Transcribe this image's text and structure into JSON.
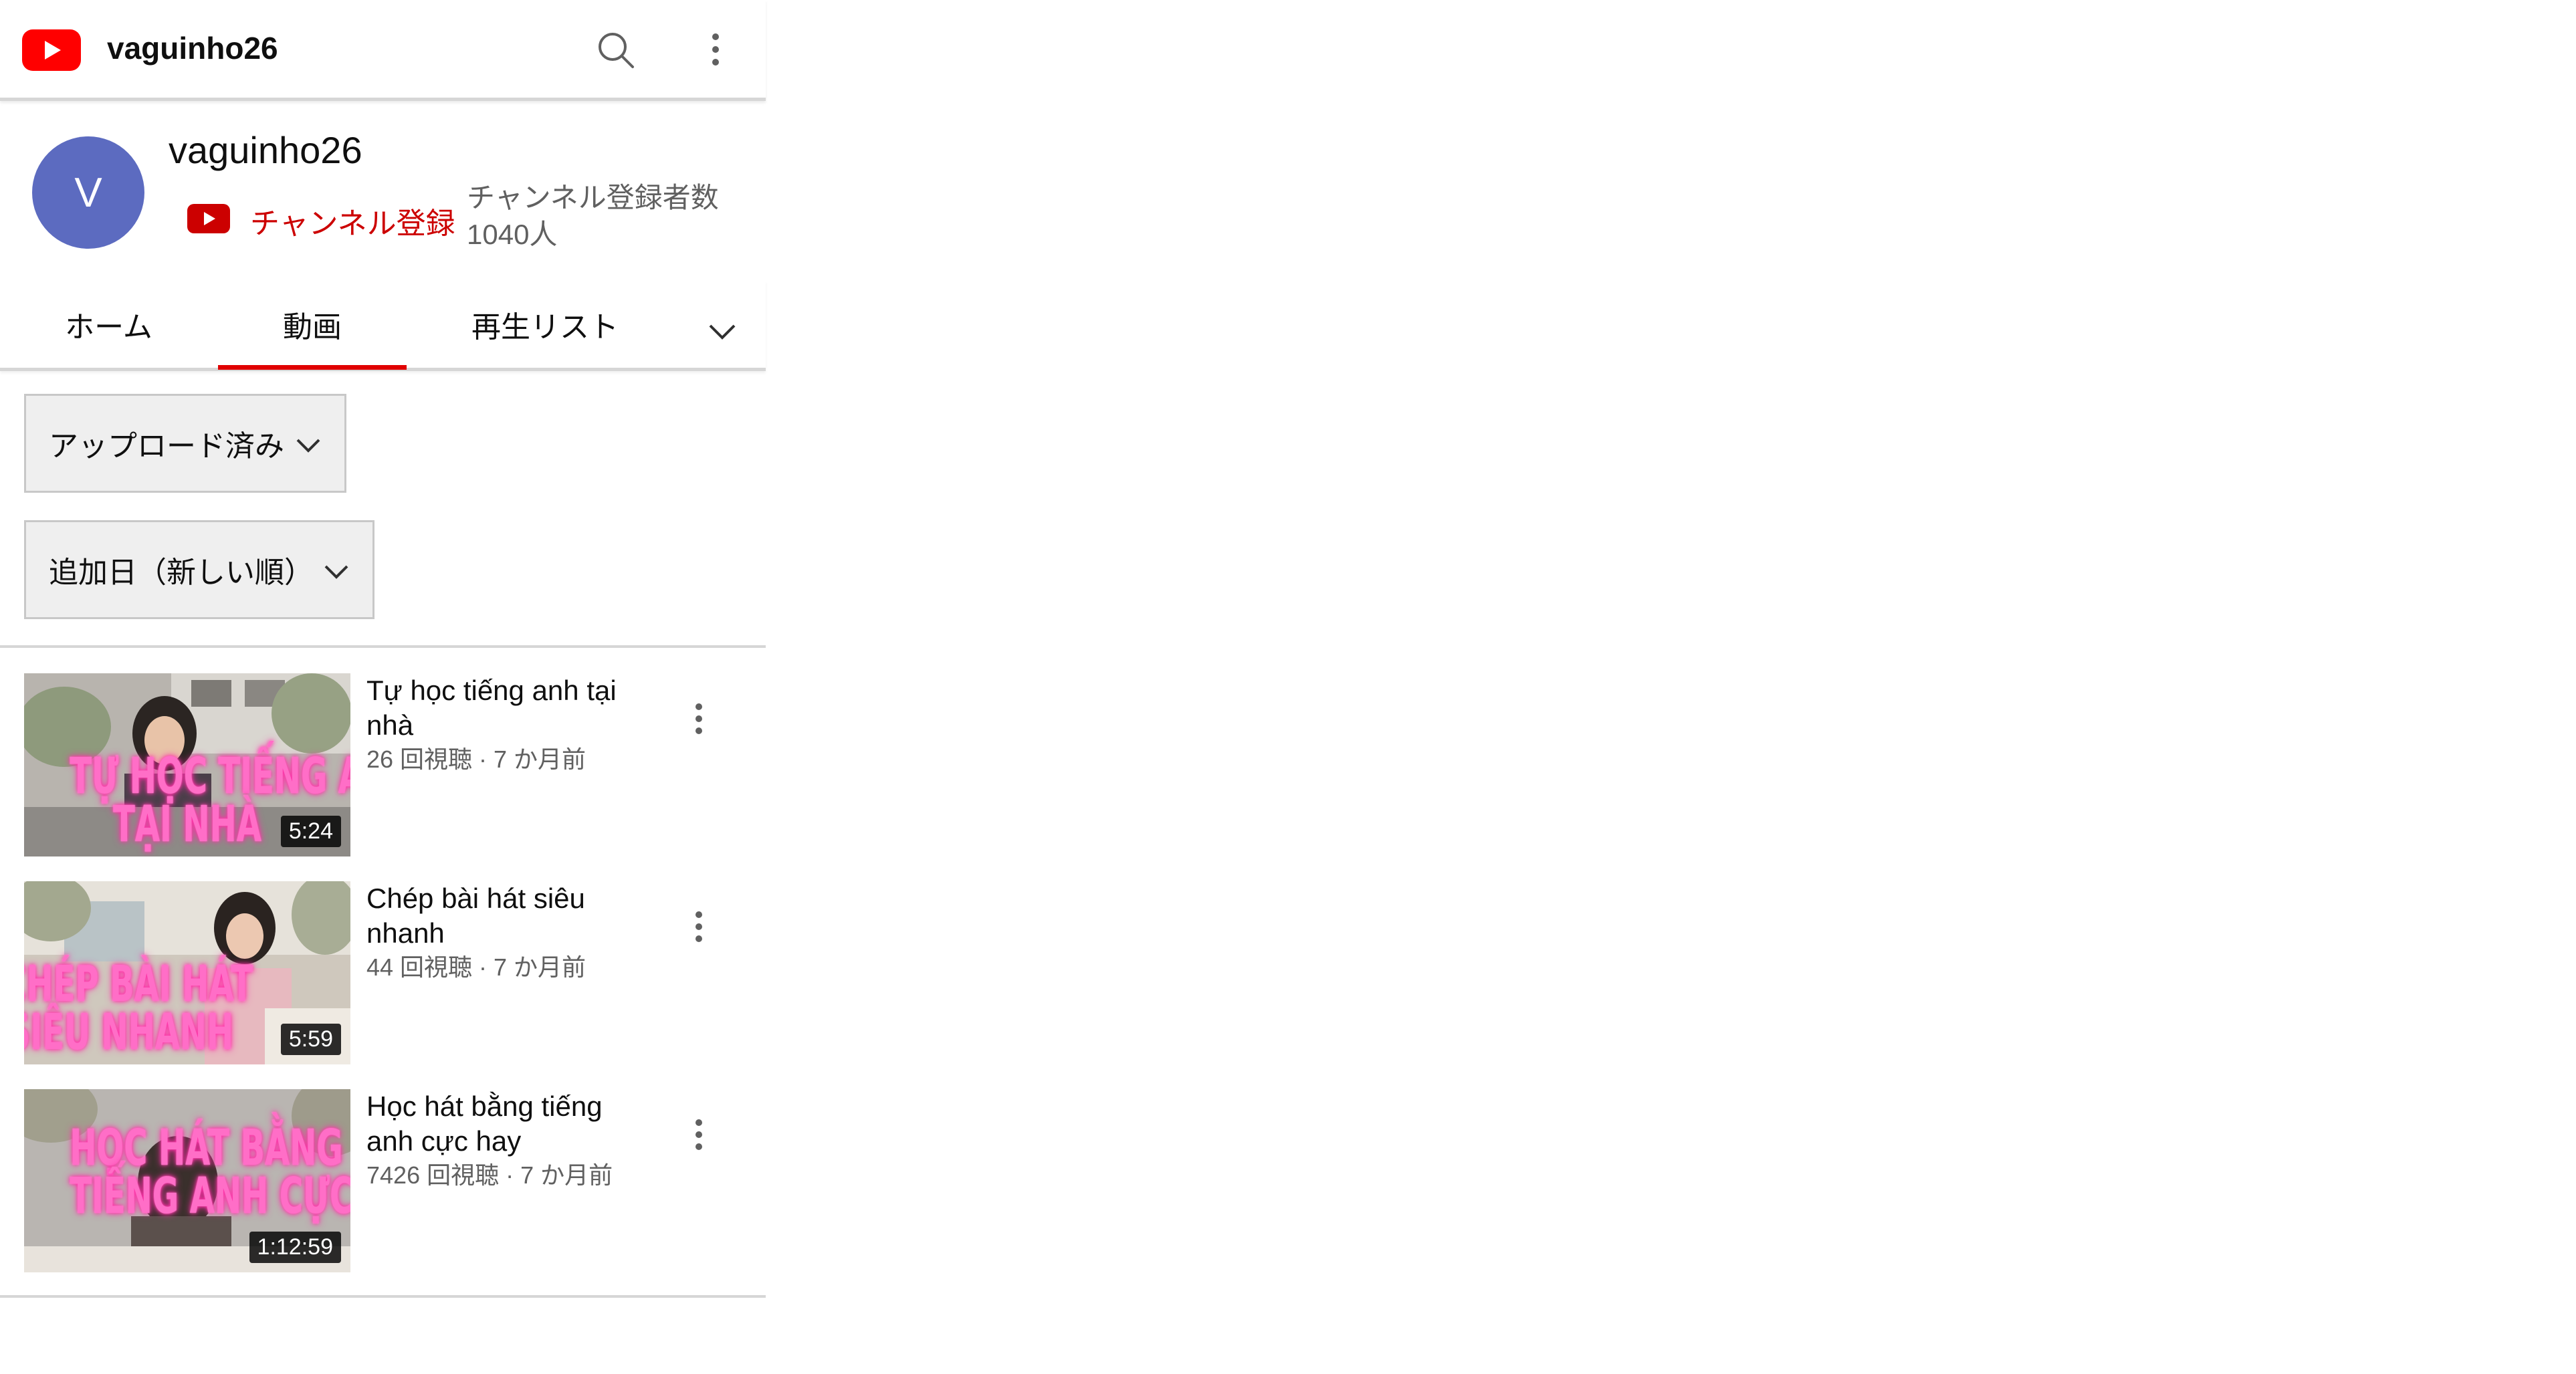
{
  "header": {
    "title": "vaguinho26",
    "logo_icon": "youtube-logo-icon",
    "search_icon": "search-icon",
    "more_icon": "more-vert-icon"
  },
  "channel": {
    "avatar_letter": "V",
    "name": "vaguinho26",
    "subscribe_label": "チャンネル登録",
    "subscriber_count": "チャンネル登録者数 1040人",
    "avatar_color": "#5c6bc0"
  },
  "tabs": [
    {
      "label": "ホーム",
      "active": false
    },
    {
      "label": "動画",
      "active": true
    },
    {
      "label": "再生リスト",
      "active": false
    }
  ],
  "filters": {
    "uploads": "アップロード済み",
    "sort": "追加日（新しい順）"
  },
  "videos": [
    {
      "title": "Tự học tiếng anh tại nhà",
      "meta": "26 回視聴 · 7 か月前",
      "duration": "5:24",
      "thumb_lines": [
        "TỰ HỌC TIẾNG ANH",
        "TẠI NHÀ"
      ]
    },
    {
      "title": "Chép bài hát siêu nhanh",
      "meta": "44 回視聴 · 7 か月前",
      "duration": "5:59",
      "thumb_lines": [
        "CHÉP BÀI HÁT",
        "SIÊU NHANH"
      ]
    },
    {
      "title": "Học hát bằng tiếng anh cực hay",
      "meta": "7426 回視聴 · 7 か月前",
      "duration": "1:12:59",
      "thumb_lines": [
        "HỌC HÁT BẰNG",
        "TIẾNG ANH CỰC HAY"
      ]
    }
  ],
  "colors": {
    "accent_red": "#e00000",
    "subscribe_red": "#cc0000",
    "thumb_text_pink": "#ff6ec7"
  }
}
